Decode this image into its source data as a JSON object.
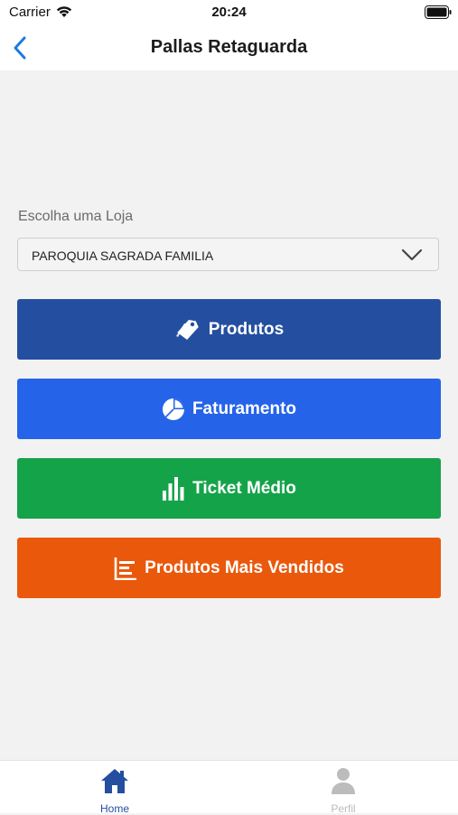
{
  "status_bar": {
    "carrier": "Carrier",
    "time": "20:24"
  },
  "nav": {
    "title": "Pallas Retaguarda",
    "back_icon": "chevron-left-icon"
  },
  "store_picker": {
    "label": "Escolha uma Loja",
    "selected": "PAROQUIA SAGRADA FAMILIA"
  },
  "menu": [
    {
      "label": "Produtos",
      "icon": "tags-icon",
      "color": "#244fa1"
    },
    {
      "label": "Faturamento",
      "icon": "pie-chart-icon",
      "color": "#2563e9"
    },
    {
      "label": "Ticket Médio",
      "icon": "bar-chart-icon",
      "color": "#15a34a"
    },
    {
      "label": "Produtos Mais Vendidos",
      "icon": "ranking-list-icon",
      "color": "#ea580c"
    }
  ],
  "tabs": [
    {
      "label": "Home",
      "icon": "home-icon",
      "active": true,
      "color": "#244fa1"
    },
    {
      "label": "Perfil",
      "icon": "user-icon",
      "active": false,
      "color": "#bcbcbc"
    }
  ],
  "colors": {
    "accent": "#1f7ae0",
    "background": "#f2f2f2"
  }
}
